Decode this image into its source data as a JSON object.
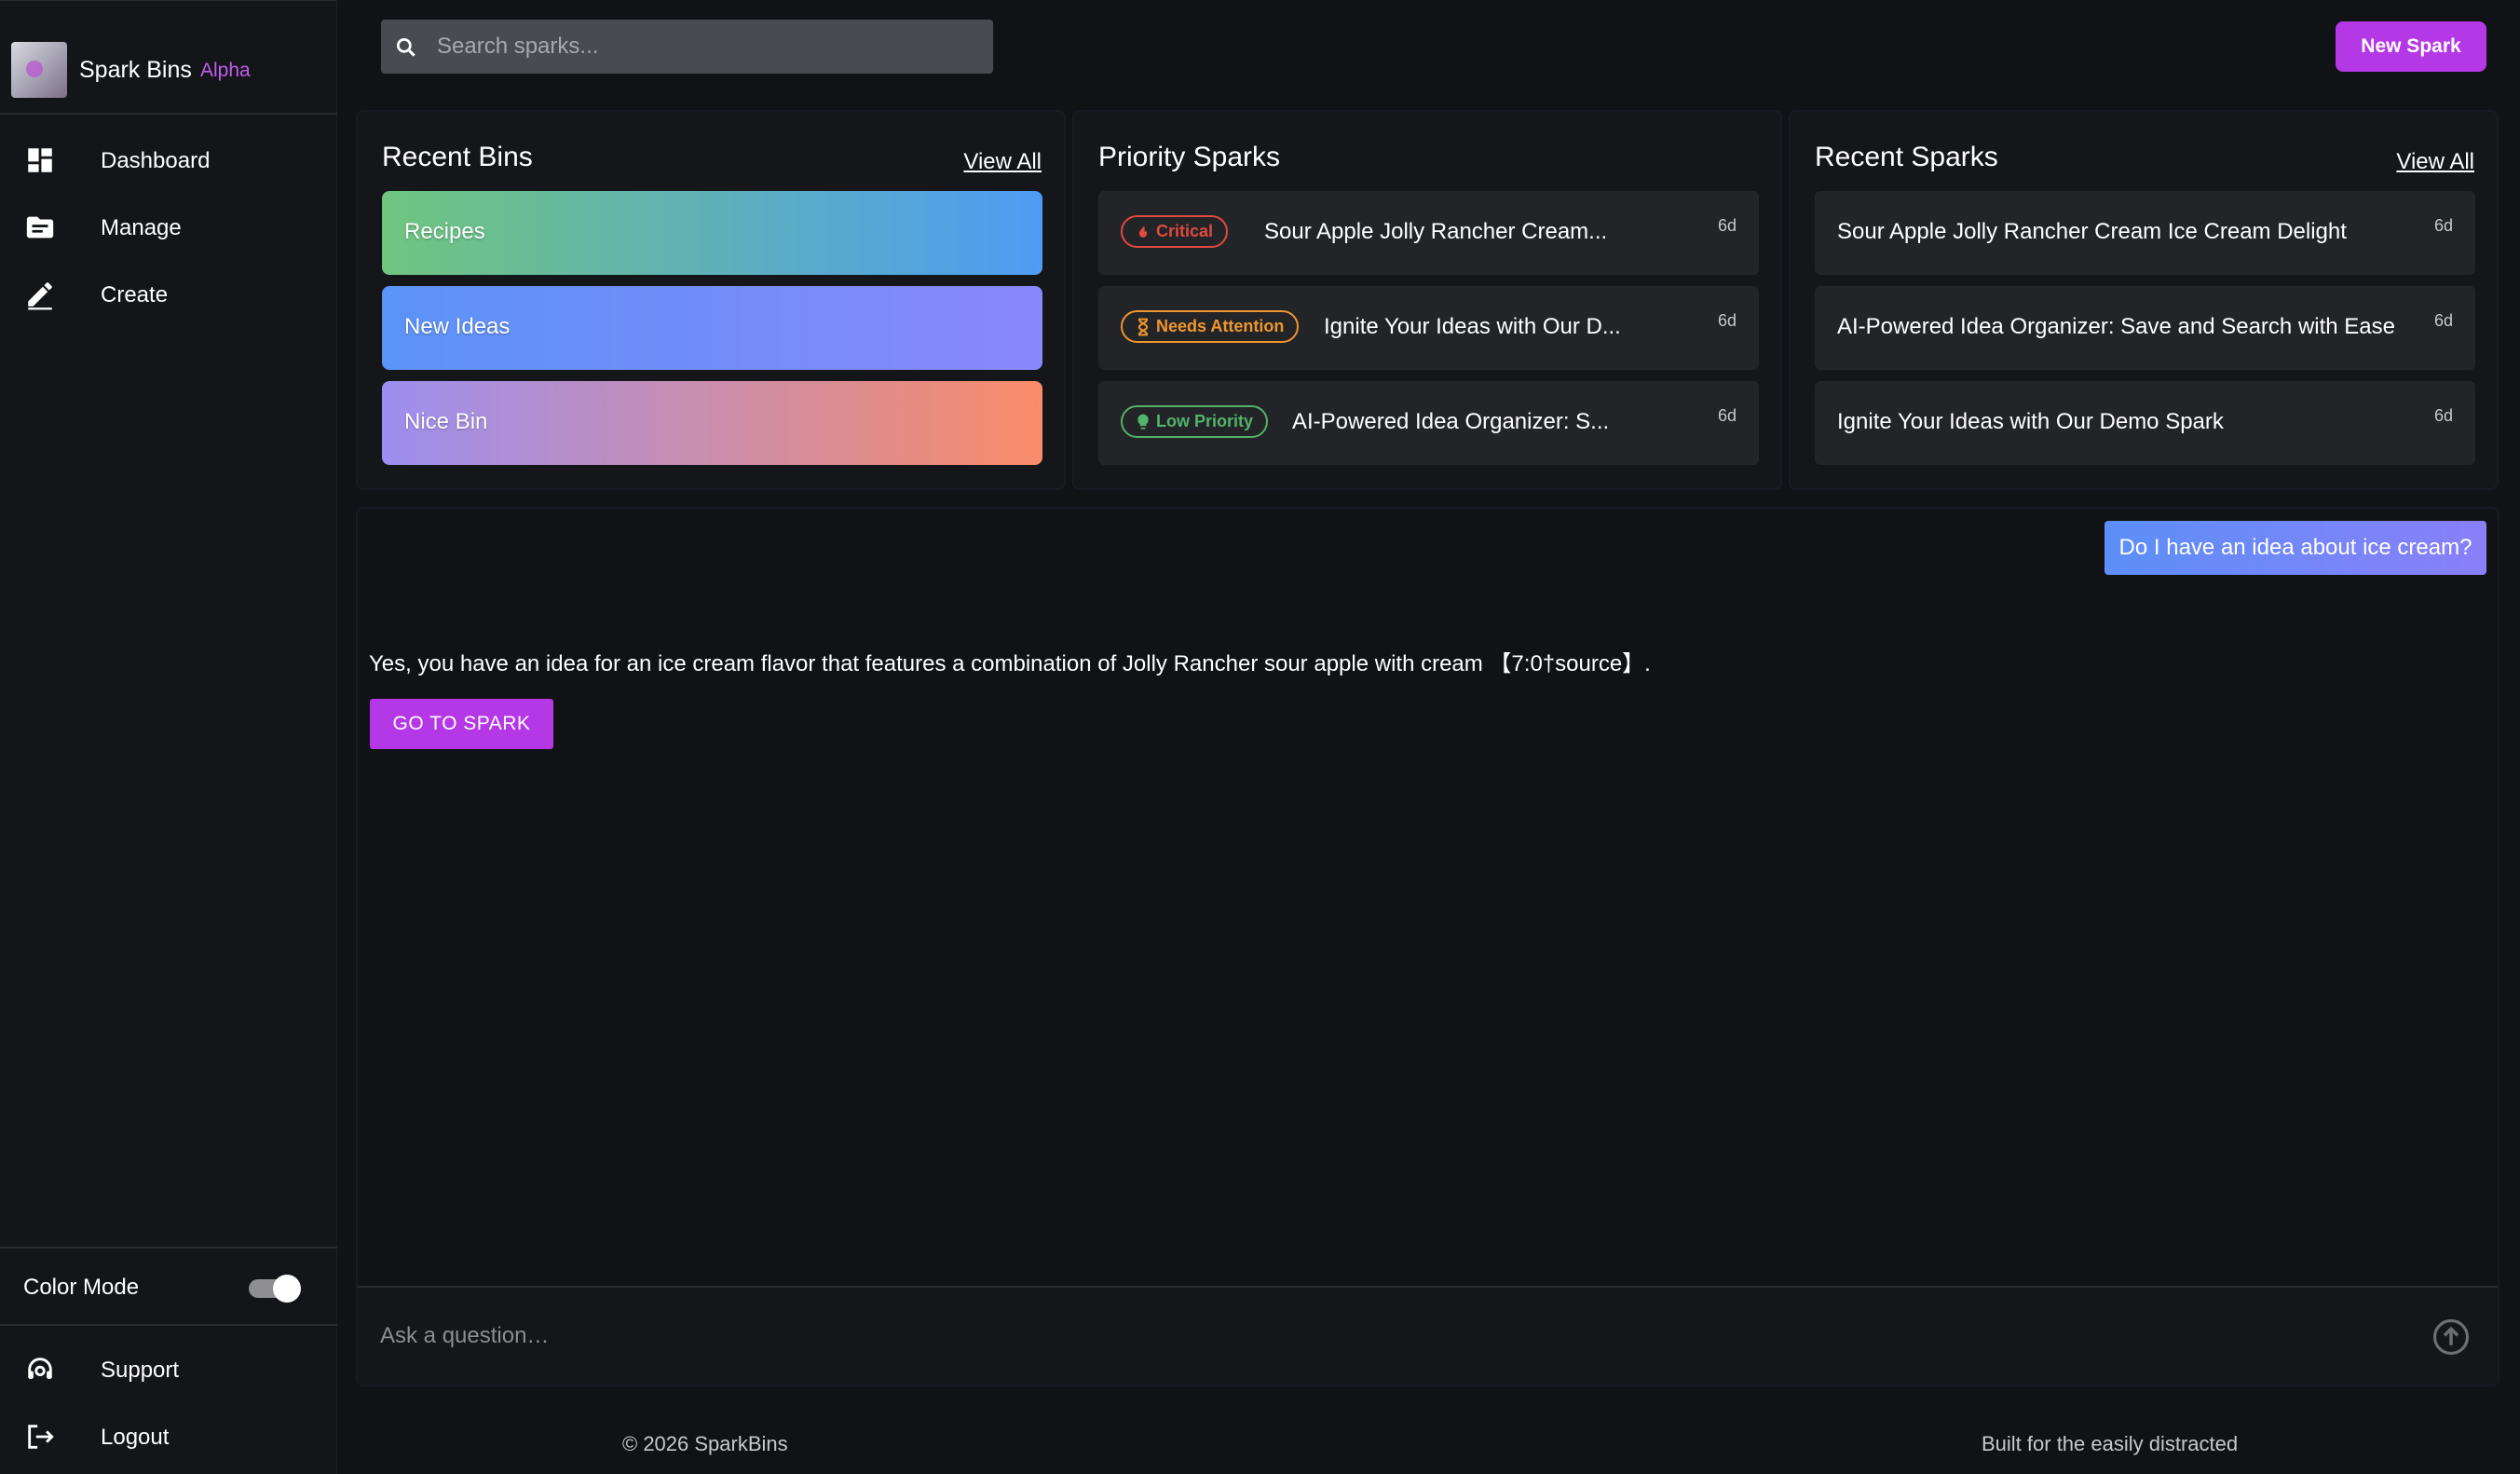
{
  "brand": {
    "name": "Spark Bins",
    "tag": "Alpha",
    "logo_icon": "app-logo-icon"
  },
  "sidebar": {
    "items": [
      {
        "label": "Dashboard",
        "icon": "dashboard-icon"
      },
      {
        "label": "Manage",
        "icon": "folder-icon"
      },
      {
        "label": "Create",
        "icon": "edit-icon"
      }
    ],
    "color_mode_label": "Color Mode",
    "color_mode_on": true,
    "bottom_items": [
      {
        "label": "Support",
        "icon": "support-agent-icon"
      },
      {
        "label": "Logout",
        "icon": "logout-icon"
      }
    ]
  },
  "search": {
    "placeholder": "Search sparks..."
  },
  "header": {
    "new_spark_label": "New Spark"
  },
  "recent_bins": {
    "title": "Recent Bins",
    "view_all": "View All",
    "bins": [
      {
        "name": "Recipes",
        "colors": [
          "#6fc57e",
          "#4e9cf4"
        ]
      },
      {
        "name": "New Ideas",
        "colors": [
          "#5b93f7",
          "#8a87fb"
        ]
      },
      {
        "name": "Nice Bin",
        "colors": [
          "#9c8ff0",
          "#f98c69"
        ]
      }
    ]
  },
  "priority_sparks": {
    "title": "Priority Sparks",
    "items": [
      {
        "badge": "Critical",
        "badge_color": "#e04a3f",
        "badge_icon": "flame-icon",
        "title": "Sour Apple Jolly Rancher Cream...",
        "age": "6d"
      },
      {
        "badge": "Needs Attention",
        "badge_color": "#f0962e",
        "badge_icon": "hourglass-icon",
        "title": "Ignite Your Ideas with Our D...",
        "age": "6d"
      },
      {
        "badge": "Low Priority",
        "badge_color": "#52b46a",
        "badge_icon": "lightbulb-icon",
        "title": "AI-Powered Idea Organizer: S...",
        "age": "6d"
      }
    ]
  },
  "recent_sparks": {
    "title": "Recent Sparks",
    "view_all": "View All",
    "items": [
      {
        "title": "Sour Apple Jolly Rancher Cream Ice Cream Delight",
        "age": "6d"
      },
      {
        "title": "AI-Powered Idea Organizer: Save and Search with Ease",
        "age": "6d"
      },
      {
        "title": "Ignite Your Ideas with Our Demo Spark",
        "age": "6d"
      }
    ]
  },
  "chat": {
    "user_message": "Do I have an idea about ice cream?",
    "answer": "Yes, you have an idea for an ice cream flavor that features a combination of Jolly Rancher sour apple with cream 【7:0†source】.",
    "go_to_spark_label": "GO TO SPARK",
    "input_placeholder": "Ask a question…"
  },
  "footer": {
    "copyright": "© 2026 SparkBins",
    "tagline": "Built for the easily distracted"
  }
}
